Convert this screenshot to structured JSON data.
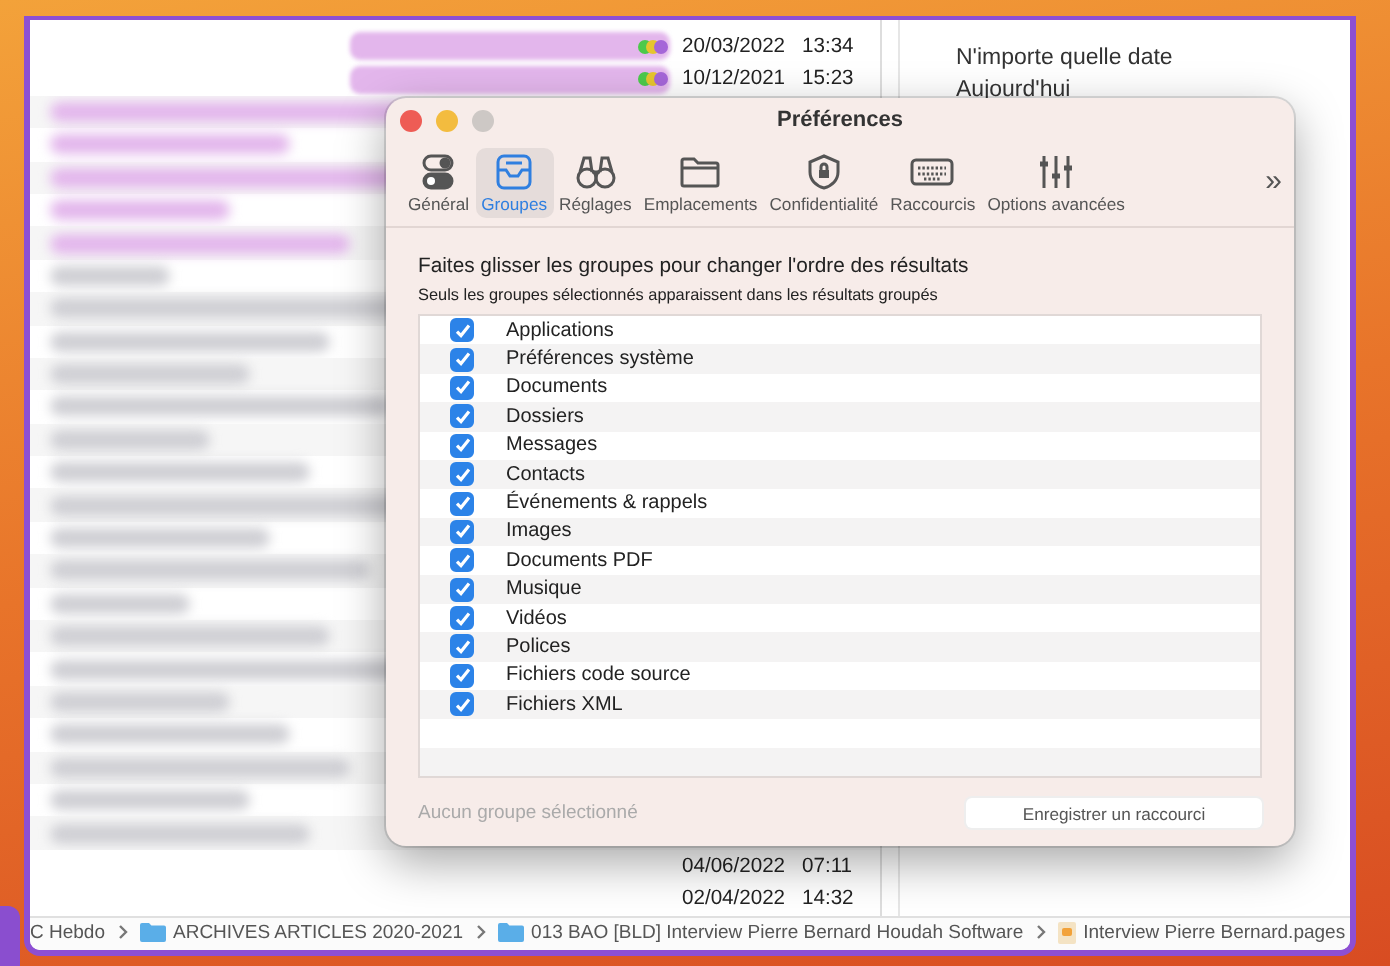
{
  "background_window": {
    "top_rows": [
      {
        "date": "20/03/2022",
        "time": "13:34"
      },
      {
        "date": "10/12/2021",
        "time": "15:23"
      }
    ],
    "bottom_rows": [
      {
        "date": "04/06/2022",
        "time": "07:11"
      },
      {
        "date": "02/04/2022",
        "time": "14:32"
      }
    ],
    "date_filters": [
      "N'importe quelle date",
      "Aujourd'hui"
    ],
    "path_bar": [
      {
        "kind": "text",
        "label": "C Hebdo"
      },
      {
        "kind": "folder",
        "label": "ARCHIVES ARTICLES 2020-2021"
      },
      {
        "kind": "folder",
        "label": "013 BAO [BLD] Interview Pierre Bernard Houdah Software"
      },
      {
        "kind": "file",
        "label": "Interview Pierre Bernard.pages"
      }
    ]
  },
  "window": {
    "title": "Préférences"
  },
  "tabs": [
    {
      "label": "Général",
      "selected": false
    },
    {
      "label": "Groupes",
      "selected": true
    },
    {
      "label": "Réglages",
      "selected": false
    },
    {
      "label": "Emplacements",
      "selected": false
    },
    {
      "label": "Confidentialité",
      "selected": false
    },
    {
      "label": "Raccourcis",
      "selected": false
    },
    {
      "label": "Options avancées",
      "selected": false
    }
  ],
  "more_tabs": "»",
  "heading": "Faites glisser les groupes pour changer l'ordre des résultats",
  "subheading": "Seuls les groupes sélectionnés apparaissent dans les résultats groupés",
  "groups": [
    {
      "label": "Applications",
      "checked": true
    },
    {
      "label": "Préférences système",
      "checked": true
    },
    {
      "label": "Documents",
      "checked": true
    },
    {
      "label": "Dossiers",
      "checked": true
    },
    {
      "label": "Messages",
      "checked": true
    },
    {
      "label": "Contacts",
      "checked": true
    },
    {
      "label": "Événements & rappels",
      "checked": true
    },
    {
      "label": "Images",
      "checked": true
    },
    {
      "label": "Documents PDF",
      "checked": true
    },
    {
      "label": "Musique",
      "checked": true
    },
    {
      "label": "Vidéos",
      "checked": true
    },
    {
      "label": "Polices",
      "checked": true
    },
    {
      "label": "Fichiers code source",
      "checked": true
    },
    {
      "label": "Fichiers XML",
      "checked": true
    }
  ],
  "status": "Aucun groupe sélectionné",
  "record_button": "Enregistrer un raccourci"
}
